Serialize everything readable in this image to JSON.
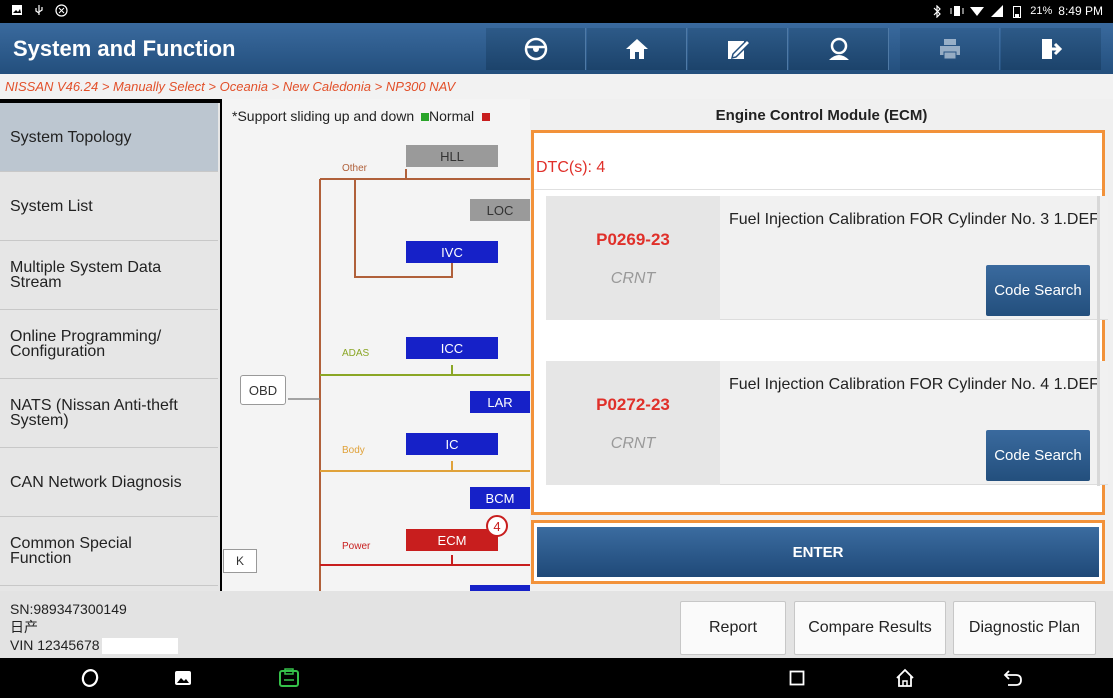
{
  "status_bar": {
    "left_icons": [
      "gallery-icon",
      "usb-icon",
      "vci-icon"
    ],
    "right_icons": [
      "bluetooth-icon",
      "vibrate-icon",
      "wifi-icon",
      "signal-icon",
      "battery-icon"
    ],
    "battery": "21%",
    "time": "8:49 PM"
  },
  "title_bar": {
    "title": "System and Function",
    "buttons": [
      "steering-wheel-icon",
      "home-icon",
      "edit-icon",
      "user-icon",
      "print-icon",
      "exit-icon"
    ]
  },
  "breadcrumb": "NISSAN V46.24 > Manually Select > Oceania > New Caledonia > NP300 NAV",
  "sidebar": {
    "items": [
      {
        "label": "System Topology"
      },
      {
        "label": "System List"
      },
      {
        "label": "Multiple System Data Stream"
      },
      {
        "label": "Online Programming/ Configuration"
      },
      {
        "label": "NATS (Nissan Anti-theft System)"
      },
      {
        "label": "CAN Network Diagnosis"
      },
      {
        "label": "Common Special Function"
      }
    ]
  },
  "topology": {
    "hint": "*Support sliding up and down",
    "legend_normal": "Normal",
    "groups": {
      "other": "Other",
      "adas": "ADAS",
      "body": "Body",
      "power": "Power"
    },
    "nodes": {
      "hll": "HLL",
      "loc": "LOC",
      "ivc": "IVC",
      "icc": "ICC",
      "lar": "LAR",
      "ic": "IC",
      "bcm": "BCM",
      "ecm": "ECM",
      "obd": "OBD"
    },
    "ecm_badge": "4",
    "collapse": "K",
    "colors": {
      "normal": "#2aa52a",
      "blue": "#1621c8",
      "red": "#c81e1e"
    }
  },
  "panel": {
    "title": "Engine Control Module (ECM)",
    "dtc_count": "DTC(s): 4",
    "dtcs": [
      {
        "code": "P0269-23",
        "status": "CRNT",
        "description": "Fuel Injection Calibration FOR Cylinder No. 3 1.DEF",
        "button": "Code Search"
      },
      {
        "code": "P0272-23",
        "status": "CRNT",
        "description": "Fuel Injection Calibration FOR Cylinder No. 4 1.DEF",
        "button": "Code Search"
      }
    ],
    "enter": "ENTER"
  },
  "bottom": {
    "sn": "SN:989347300149",
    "make": "日产",
    "vin": "VIN 12345678",
    "buttons": {
      "report": "Report",
      "compare": "Compare Results",
      "plan": "Diagnostic Plan"
    }
  },
  "navbar": {
    "icons": [
      "browser-icon",
      "gallery-icon",
      "vci-app-icon",
      "recents-icon",
      "home-icon",
      "back-icon"
    ]
  }
}
